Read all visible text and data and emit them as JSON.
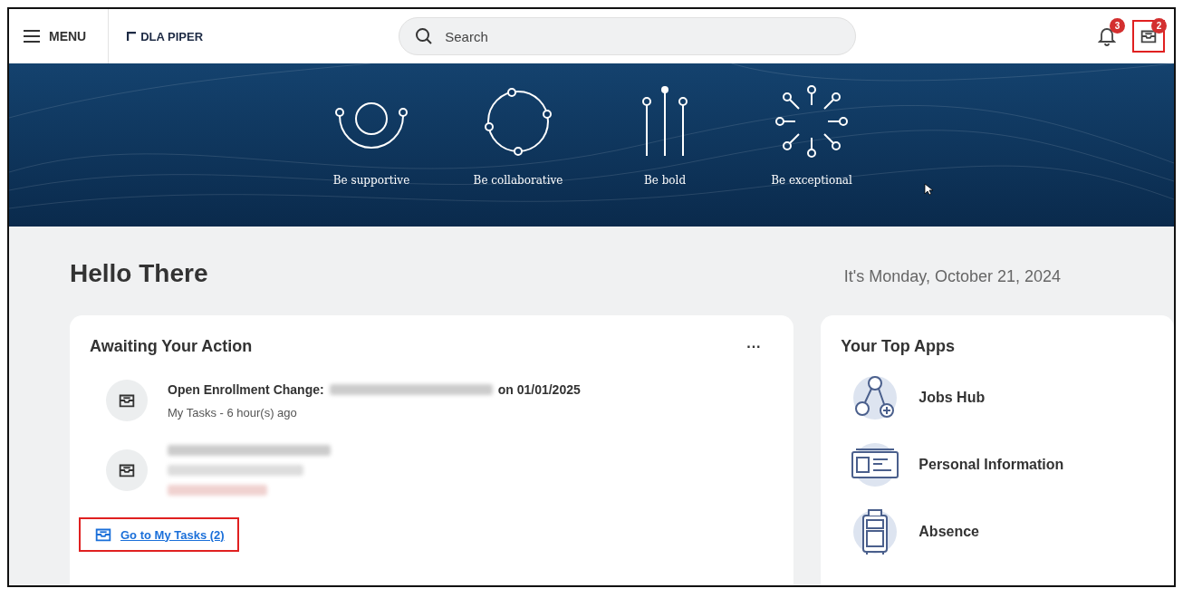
{
  "top_bar": {
    "menu_label": "MENU",
    "logo_text": "DLA PIPER",
    "search": {
      "placeholder": "Search"
    },
    "notifications": {
      "badge": "3",
      "highlighted": false
    },
    "inbox": {
      "badge": "2",
      "highlighted": true
    }
  },
  "banner": {
    "values": [
      {
        "kind": "supportive",
        "label": "Be supportive"
      },
      {
        "kind": "collaborative",
        "label": "Be collaborative"
      },
      {
        "kind": "bold",
        "label": "Be bold"
      },
      {
        "kind": "exceptional",
        "label": "Be exceptional"
      }
    ]
  },
  "greeting": "Hello There",
  "date": "It's Monday, October 21, 2024",
  "awaiting": {
    "title": "Awaiting Your Action",
    "more": "···",
    "tasks": [
      {
        "lines": [
          {
            "kind": "title",
            "parts": [
              {
                "kind": "text",
                "text": "Open Enrollment Change:"
              },
              {
                "kind": "redacted"
              },
              {
                "kind": "text",
                "text": "on 01/01/2025"
              }
            ]
          },
          {
            "kind": "meta",
            "parts": [
              {
                "kind": "text",
                "text": "My Tasks - 6 hour(s) ago"
              }
            ]
          }
        ]
      },
      {
        "lines": [
          {
            "kind": "title",
            "parts": [
              {
                "kind": "redacted"
              }
            ]
          },
          {
            "kind": "meta",
            "parts": [
              {
                "kind": "redacted"
              }
            ]
          },
          {
            "kind": "due",
            "parts": [
              {
                "kind": "redacted"
              }
            ]
          }
        ]
      }
    ],
    "link": {
      "text": "Go to My Tasks (2)",
      "highlighted": true
    }
  },
  "top_apps": {
    "title": "Your Top Apps",
    "apps": [
      {
        "kind": "jobs",
        "label": "Jobs Hub"
      },
      {
        "kind": "personal",
        "label": "Personal Information"
      },
      {
        "kind": "absence",
        "label": "Absence"
      }
    ]
  }
}
